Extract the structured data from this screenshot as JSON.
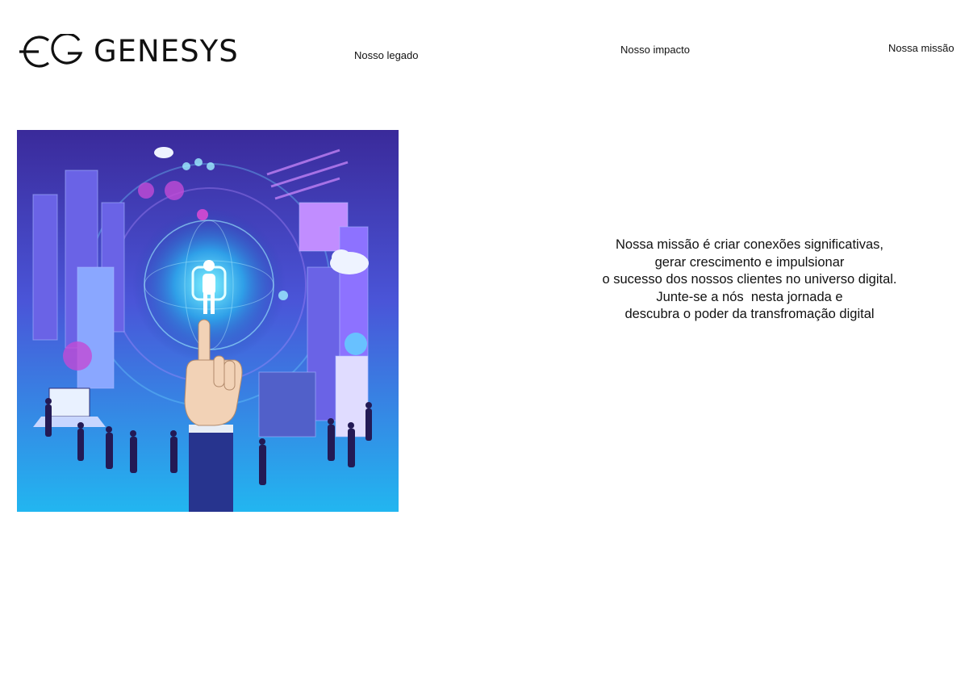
{
  "brand": {
    "name": "GENESYS",
    "logo_icon": "gg-monogram-icon"
  },
  "nav": {
    "items": [
      {
        "label": "Nosso legado"
      },
      {
        "label": "Nosso impacto"
      },
      {
        "label": "Nossa missão"
      }
    ]
  },
  "hero": {
    "image_subject": "digital-city-illustration",
    "colors": {
      "top": "#3a2a9a",
      "bottom": "#22b6f0",
      "glow": "#7ff3ff",
      "accent": "#c24bd6"
    }
  },
  "mission": {
    "lines": [
      "Nossa missão é criar conexões significativas,",
      "gerar crescimento e impulsionar",
      "o sucesso dos nossos clientes no universo digital.",
      "Junte-se a nós  nesta jornada e",
      "descubra o poder da transfromação digital"
    ]
  }
}
